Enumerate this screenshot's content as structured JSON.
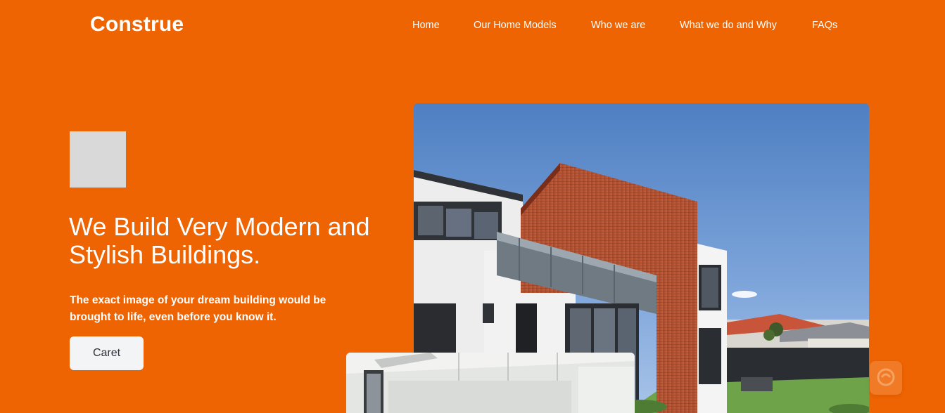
{
  "brand": {
    "logo_text": "Construe",
    "primary_color": "#EE6302"
  },
  "nav": {
    "items": [
      {
        "label": "Home"
      },
      {
        "label": "Our Home Models"
      },
      {
        "label": "Who we are"
      },
      {
        "label": "What we do and Why"
      },
      {
        "label": "FAQs"
      }
    ]
  },
  "hero": {
    "headline": "We Build Very Modern and Stylish Buildings.",
    "subtext": "The exact image of your dream building would be brought to life, even before you know it.",
    "cta_label": "Caret",
    "image_main": "modern-house-photo",
    "image_secondary": "interior-photo"
  },
  "widget": {
    "icon": "chat-widget-icon"
  }
}
